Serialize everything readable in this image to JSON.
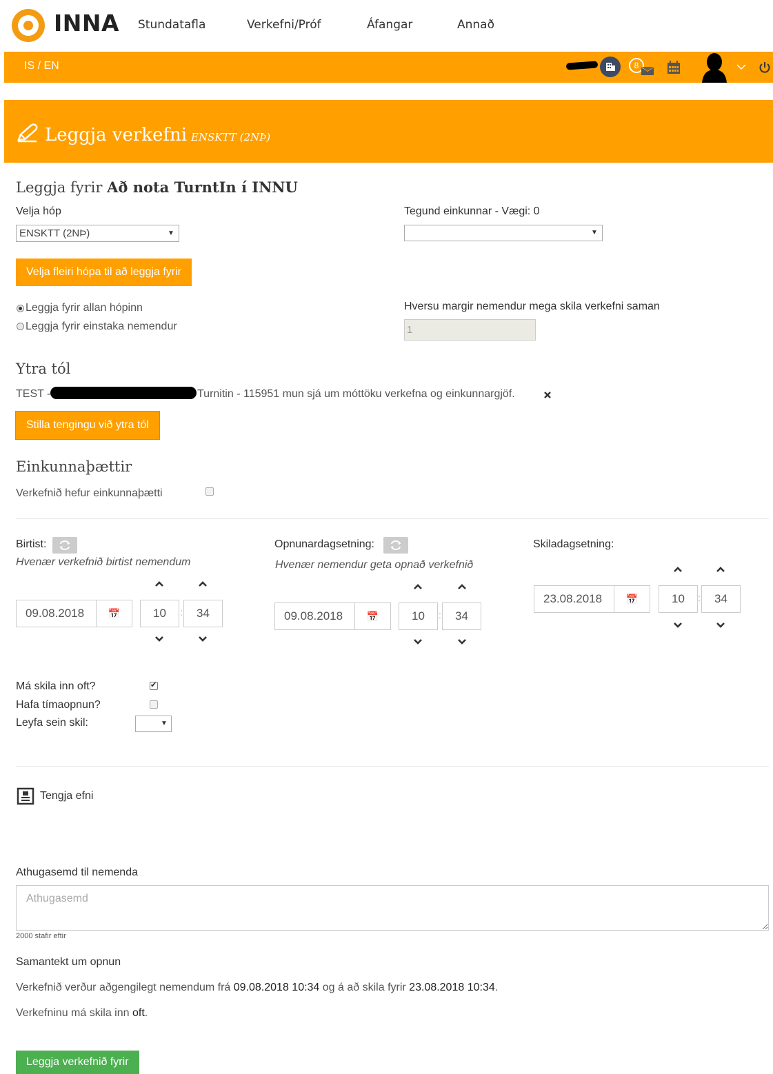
{
  "brand": {
    "name": "INNA"
  },
  "nav": [
    {
      "label": "Stundatafla"
    },
    {
      "label": "Verkefni/Próf"
    },
    {
      "label": "Áfangar"
    },
    {
      "label": "Annað"
    }
  ],
  "toolbar": {
    "lang": "IS / EN",
    "message_count": "8"
  },
  "header": {
    "title": "Leggja verkefni",
    "subtitle": "ENSKTT (2NÞ)"
  },
  "assign": {
    "prefix": "Leggja fyrir",
    "name": "Að nota TurntIn í INNU"
  },
  "group": {
    "label": "Velja hóp",
    "selected": "ENSKTT (2NÞ)"
  },
  "grade": {
    "label": "Tegund einkunnar - Vægi: 0",
    "selected": ""
  },
  "more_groups_button": "Velja fleiri hópa til að leggja fyrir",
  "radios": [
    {
      "label": "Leggja fyrir allan hópinn",
      "checked": true
    },
    {
      "label": "Leggja fyrir einstaka nemendur",
      "checked": false
    }
  ],
  "students_together": {
    "label": "Hversu margir nemendur mega skila verkefni saman",
    "value": "1"
  },
  "external": {
    "heading": "Ytra tól",
    "prefix": "TEST -",
    "text": "Turnitin - 115951 mun sjá um móttöku verkefna og einkunnargjöf.",
    "button": "Stilla tengingu við ytra tól"
  },
  "grade_parts": {
    "heading": "Einkunnaþættir",
    "label": "Verkefnið hefur einkunnaþætti"
  },
  "dates": {
    "publish": {
      "label": "Birtist:",
      "hint": "Hvenær verkefnið birtist nemendum",
      "date": "09.08.2018",
      "hour": "10",
      "minute": "34"
    },
    "open": {
      "label": "Opnunardagsetning:",
      "hint": "Hvenær nemendur geta opnað verkefnið",
      "date": "09.08.2018",
      "hour": "10",
      "minute": "34"
    },
    "due": {
      "label": "Skiladagsetning:",
      "date": "23.08.2018",
      "hour": "10",
      "minute": "34"
    }
  },
  "options": {
    "multi_submit": "Má skila inn oft?",
    "time_open": "Hafa tímaopnun?",
    "late": "Leyfa sein skil:"
  },
  "link_content": "Tengja efni",
  "note": {
    "label": "Athugasemd til nemenda",
    "placeholder": "Athugasemd",
    "remaining": "2000 stafir eftir"
  },
  "summary": {
    "heading": "Samantekt um opnun",
    "line1_a": "Verkefnið verður aðgengilegt nemendum frá",
    "line1_b": "09.08.2018 10:34",
    "line1_c": "og á að skila fyrir",
    "line1_d": "23.08.2018 10:34",
    "line1_e": ".",
    "line2_a": "Verkefninu má skila inn",
    "line2_b": "oft",
    "line2_c": "."
  },
  "submit_button": "Leggja verkefnið fyrir"
}
